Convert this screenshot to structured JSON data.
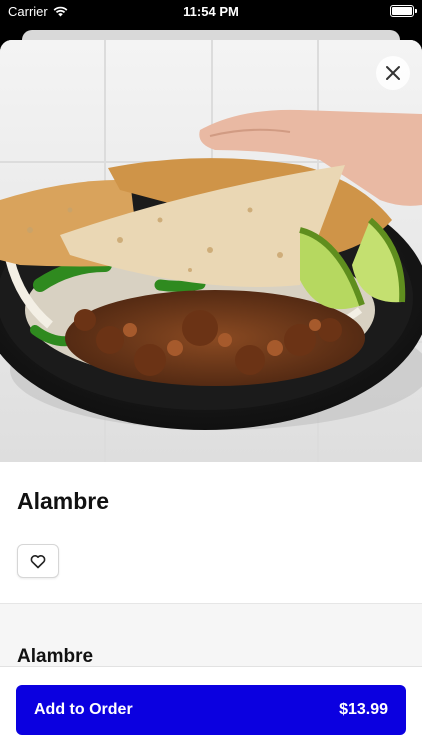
{
  "status_bar": {
    "carrier": "Carrier",
    "time": "11:54 PM",
    "icons": [
      "wifi-icon",
      "battery-icon"
    ]
  },
  "item": {
    "name": "Alambre",
    "image": "alambre-dish-photo"
  },
  "actions": {
    "close_icon": "close-icon",
    "favorite_icon": "heart-icon"
  },
  "section": {
    "title": "Alambre"
  },
  "footer": {
    "button_label": "Add to Order",
    "price": "$13.99"
  },
  "colors": {
    "primary": "#0b00e0",
    "section_bg": "#f6f6f6"
  }
}
